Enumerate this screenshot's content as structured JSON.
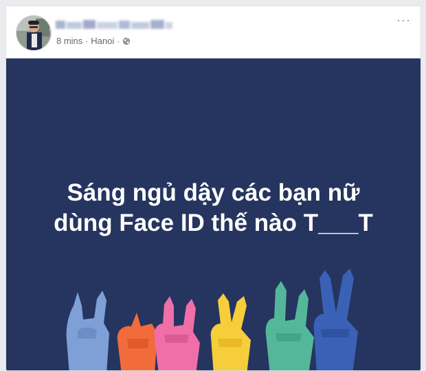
{
  "post": {
    "time": "8 mins",
    "separator": "·",
    "location": "Hanoi",
    "privacy_icon": "globe-icon",
    "more_icon": "more-options-icon",
    "more_label": "···"
  },
  "image": {
    "line1": "Sáng ngủ dậy các bạn nữ",
    "line2": "dùng Face ID thế nào T___T",
    "background": "#25355f"
  }
}
